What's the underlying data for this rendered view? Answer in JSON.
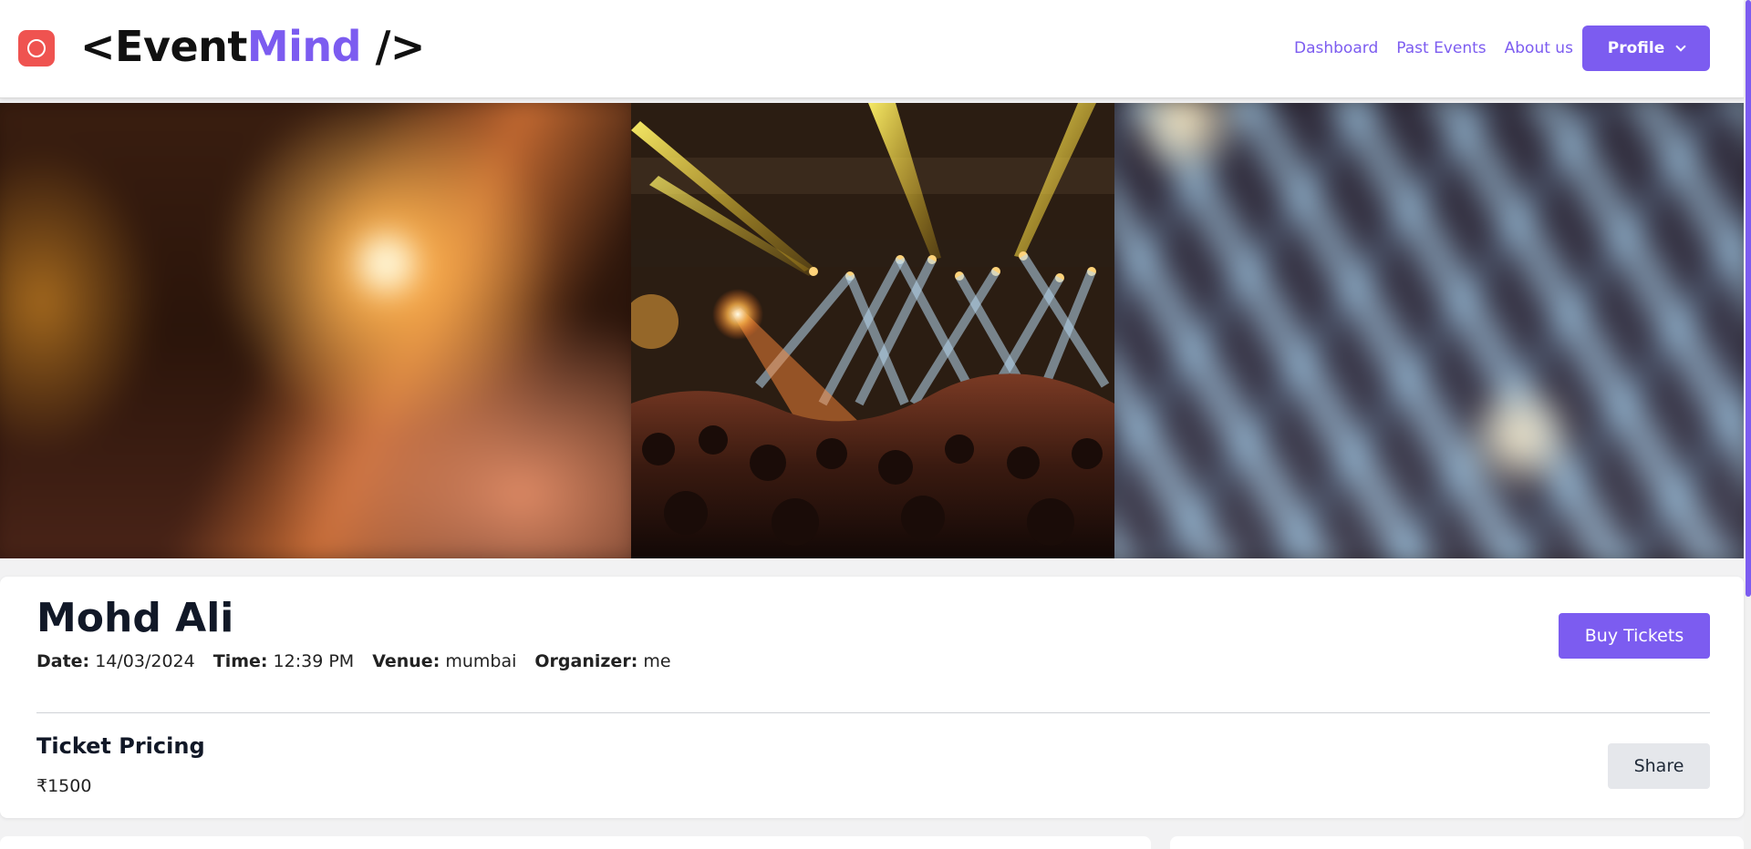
{
  "header": {
    "logo_prefix": "<Event",
    "logo_accent": "Mind",
    "logo_suffix": " />",
    "nav": [
      "Dashboard",
      "Past Events",
      "About us"
    ],
    "profile_label": "Profile"
  },
  "event": {
    "title": "Mohd Ali",
    "date_key": "Date:",
    "date_value": "14/03/2024",
    "time_key": "Time:",
    "time_value": "12:39 PM",
    "venue_key": "Venue:",
    "venue_value": "mumbai",
    "organizer_key": "Organizer:",
    "organizer_value": "me",
    "buy_label": "Buy Tickets",
    "pricing_title": "Ticket Pricing",
    "price": "₹1500",
    "share_label": "Share"
  },
  "colors": {
    "accent": "#7c5cf0",
    "logo_badge": "#ef5350",
    "share_bg": "#e5e7eb"
  }
}
